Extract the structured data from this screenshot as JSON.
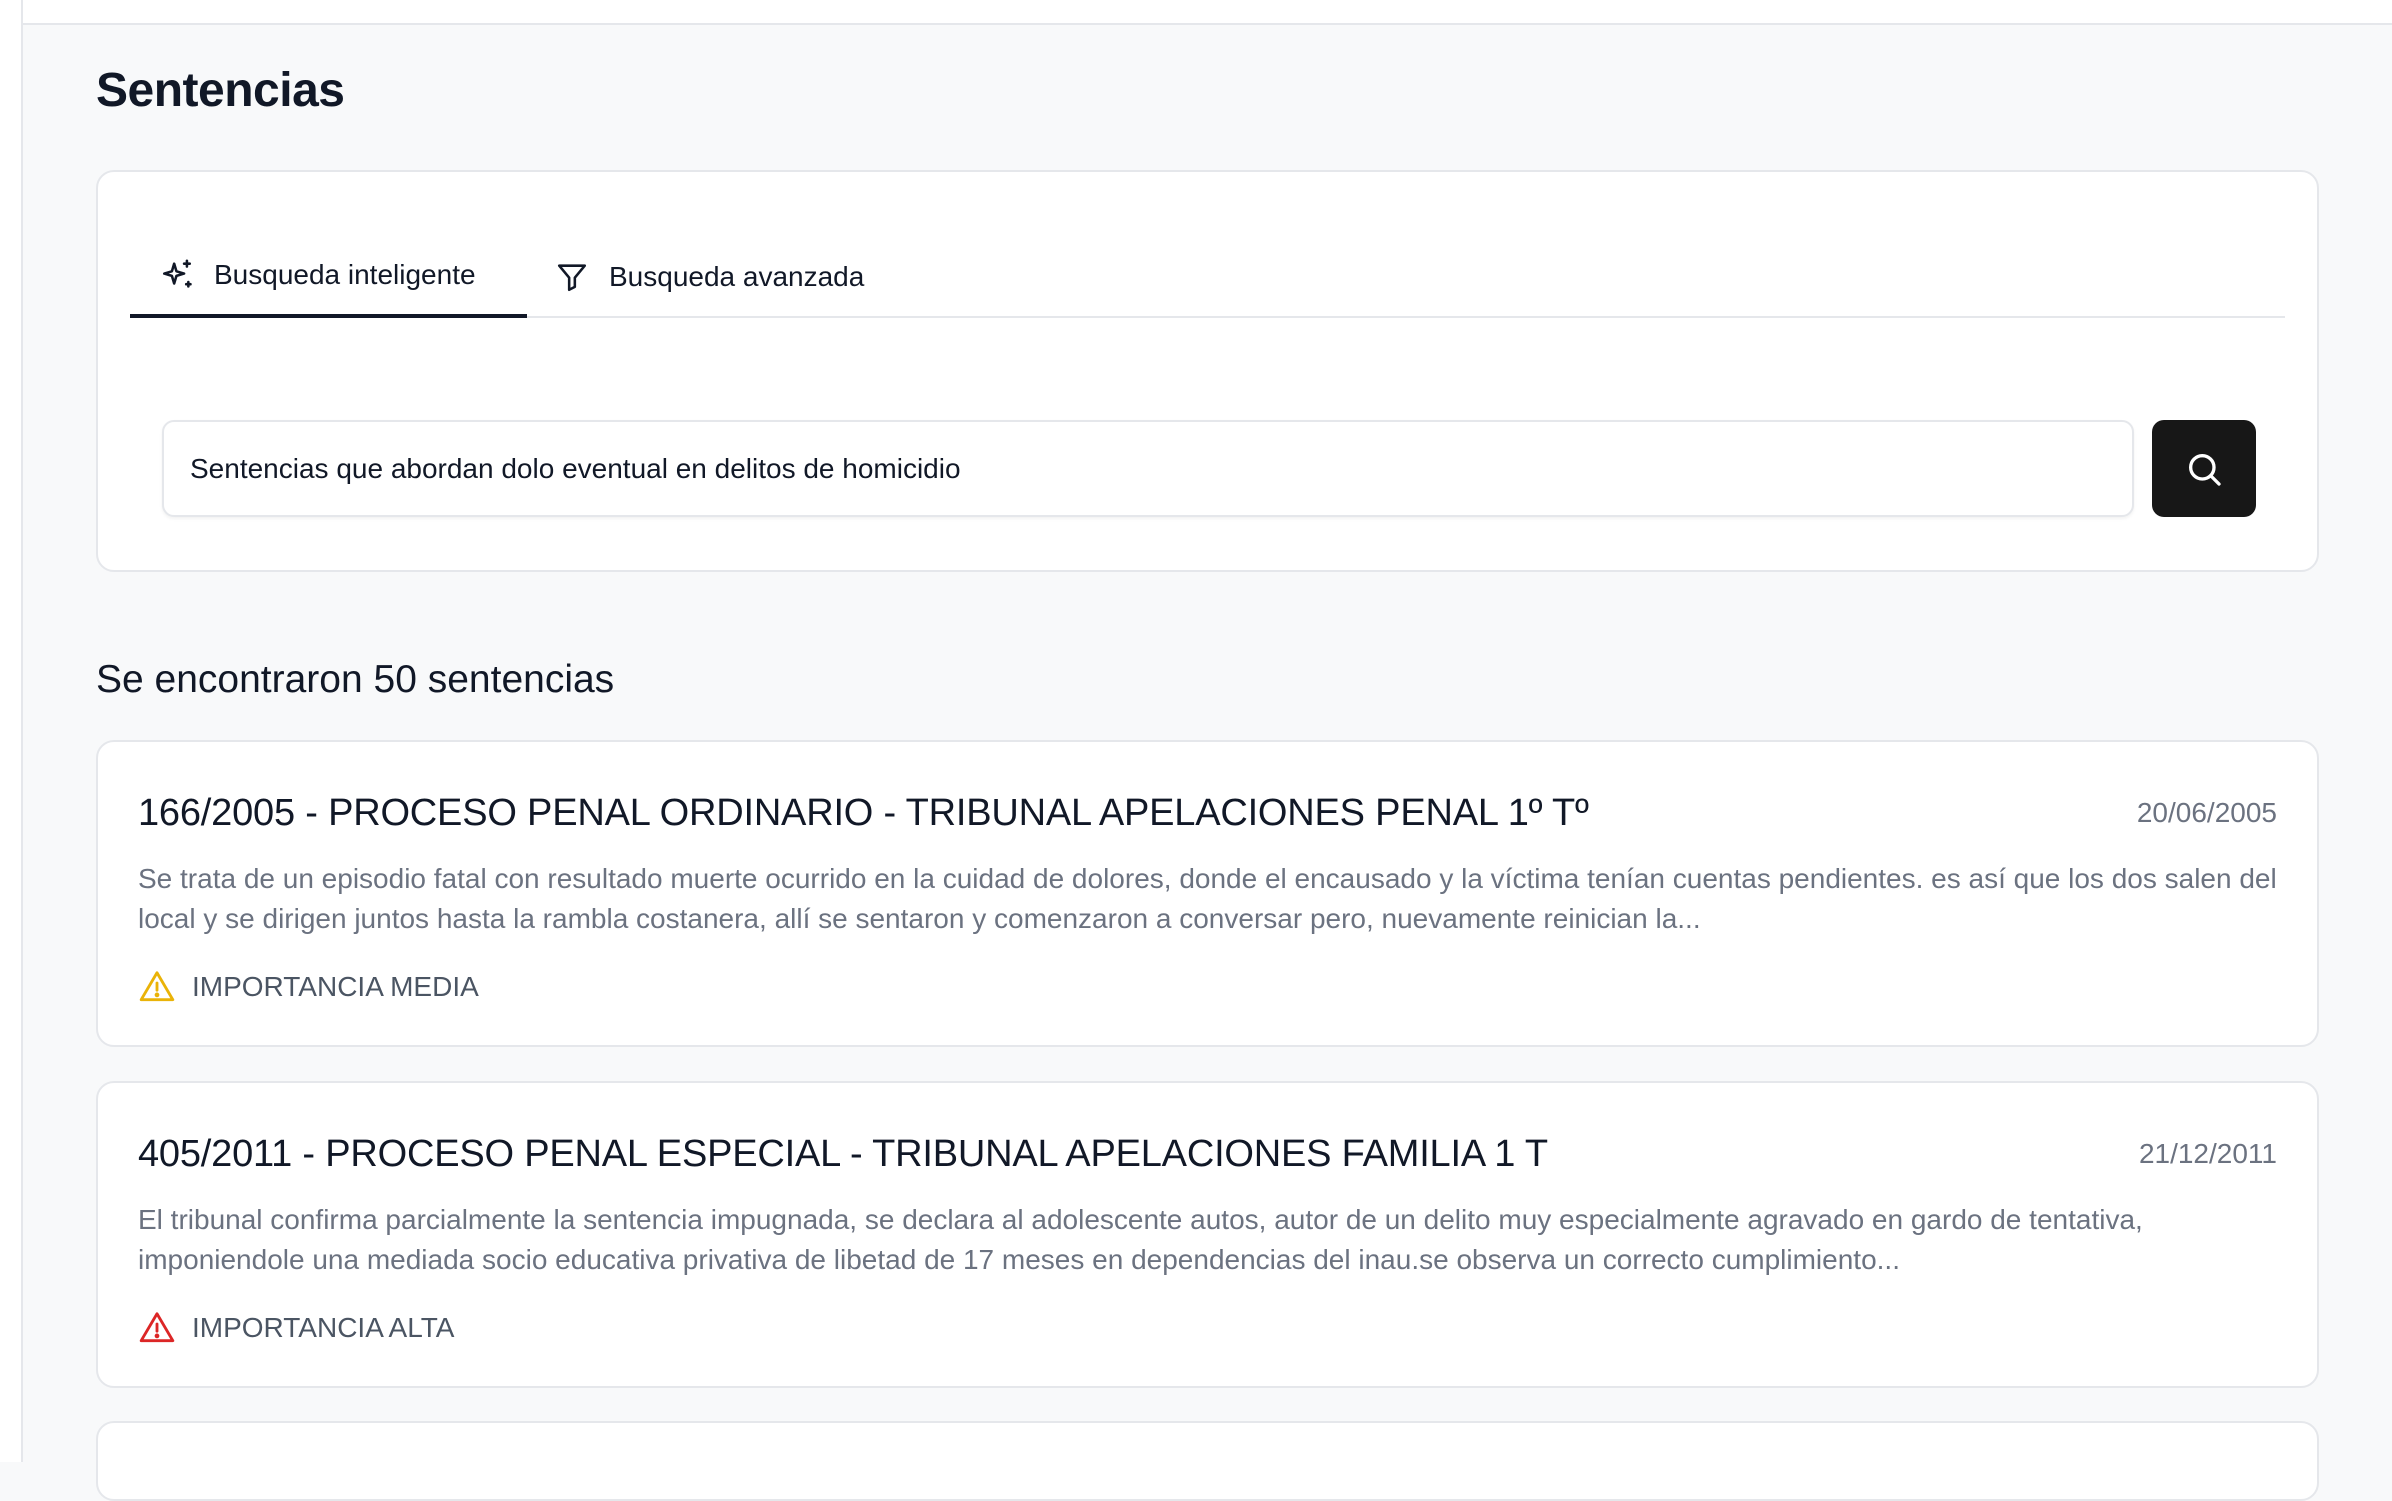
{
  "page": {
    "title": "Sentencias"
  },
  "search": {
    "tabs": [
      {
        "label": "Busqueda inteligente",
        "icon": "sparkles-icon",
        "active": true
      },
      {
        "label": "Busqueda avanzada",
        "icon": "filter-icon",
        "active": false
      }
    ],
    "query": "Sentencias que abordan dolo eventual en delitos de homicidio",
    "button_icon": "search-icon"
  },
  "results": {
    "heading": "Se encontraron 50 sentencias",
    "items": [
      {
        "title": "166/2005 - PROCESO PENAL ORDINARIO - TRIBUNAL APELACIONES PENAL 1º Tº",
        "date": "20/06/2005",
        "summary": "Se trata de un episodio fatal con resultado muerte ocurrido en la cuidad de dolores, donde el encausado y la víctima tenían cuentas pendientes. es así que los dos salen del local y se dirigen juntos hasta la rambla costanera, allí se sentaron y comenzaron a conversar pero, nuevamente reinician la...",
        "importance": "IMPORTANCIA MEDIA",
        "importance_icon": "warning-triangle-icon",
        "importance_color": "#eab308"
      },
      {
        "title": "405/2011 - PROCESO PENAL ESPECIAL - TRIBUNAL APELACIONES FAMILIA 1 T",
        "date": "21/12/2011",
        "summary": "El tribunal confirma parcialmente la sentencia impugnada, se declara al adolescente autos, autor de un delito muy especialmente agravado en gardo de tentativa, imponiendole una mediada socio educativa privativa de libetad de 17 meses en dependencias del inau.se observa un correcto cumplimiento...",
        "importance": "IMPORTANCIA ALTA",
        "importance_icon": "warning-triangle-icon",
        "importance_color": "#dc2626"
      }
    ]
  },
  "colors": {
    "background": "#f8f9fa",
    "card": "#ffffff",
    "border": "#e5e7eb",
    "primary_button": "#171717",
    "muted_text": "#6b7280"
  }
}
